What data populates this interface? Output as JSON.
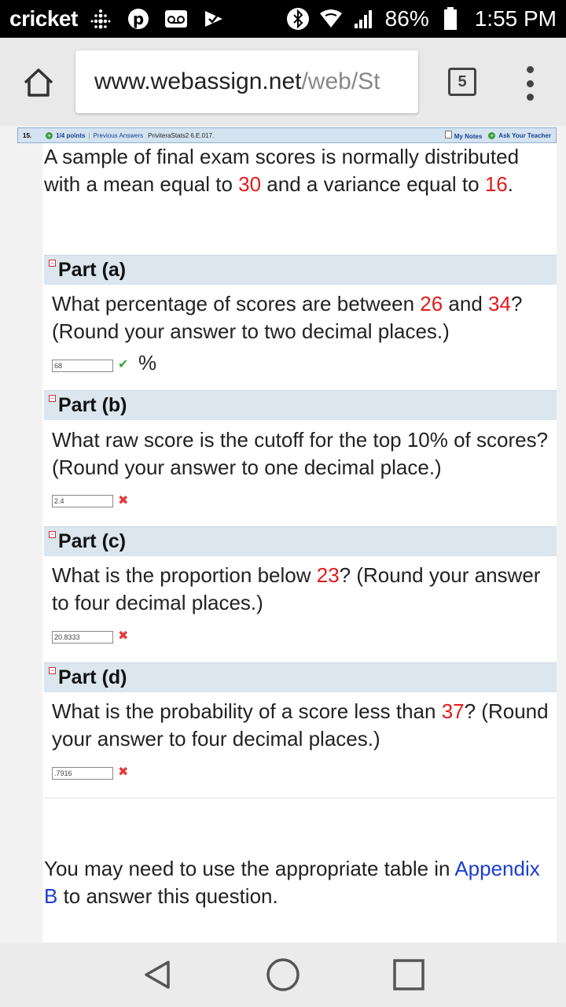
{
  "status_bar": {
    "carrier": "cricket",
    "battery": "86%",
    "time": "1:55 PM",
    "icons": [
      "fitbit-icon",
      "pinterest-icon",
      "voicemail-icon",
      "check-app-icon",
      "bluetooth-icon",
      "wifi-icon",
      "signal-icon",
      "battery-icon"
    ]
  },
  "browser": {
    "url_domain": "www.webassign.net",
    "url_path": "/web/St",
    "tab_count": "5"
  },
  "question": {
    "number": "15.",
    "points": "1/4 points",
    "previous_answers": "Previous Answers",
    "source": "PriviteraStats2 6.E.017.",
    "my_notes": "My Notes",
    "ask_teacher": "Ask Your Teacher",
    "intro": {
      "t1": "A sample of final exam scores is normally distributed with a mean equal to ",
      "mean": "30",
      "t2": " and a variance equal to ",
      "variance": "16",
      "t3": "."
    }
  },
  "parts": [
    {
      "title": "Part (a)",
      "t1": "What percentage of scores are between ",
      "v1": "26",
      "t2": " and ",
      "v2": "34",
      "t3": "? (Round your answer to two decimal places.)",
      "answer": "68",
      "unit": "%",
      "status": "correct"
    },
    {
      "title": "Part (b)",
      "t1": "What raw score is the cutoff for the top 10% of scores? (Round your answer to one decimal place.)",
      "answer": "2.4",
      "status": "incorrect"
    },
    {
      "title": "Part (c)",
      "t1": "What is the proportion below ",
      "v1": "23",
      "t2": "? (Round your answer to four decimal places.)",
      "answer": "20.8333",
      "status": "incorrect"
    },
    {
      "title": "Part (d)",
      "t1": "What is the probability of a score less than ",
      "v1": "37",
      "t2": "? (Round your answer to four decimal places.)",
      "answer": ".7916",
      "status": "incorrect"
    }
  ],
  "footer": {
    "t1": "You may need to use the appropriate table in ",
    "link": "Appendix B",
    "t2": " to answer this question."
  },
  "nav": {
    "buttons": [
      "back-icon",
      "home-circle-icon",
      "recents-icon"
    ]
  }
}
